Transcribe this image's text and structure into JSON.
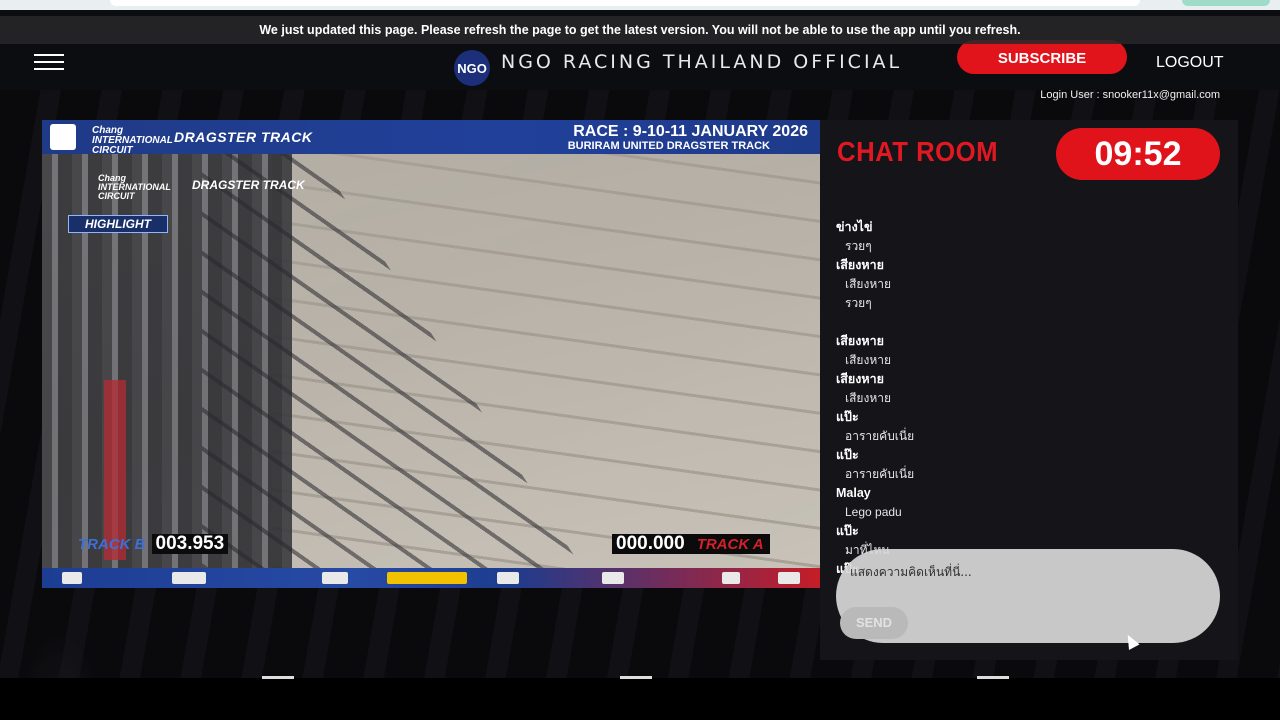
{
  "banner": {
    "text": "We just updated this page. Please refresh the page to get the latest version. You will not be able to use the app until you refresh."
  },
  "header": {
    "title": "NGO RACING THAILAND OFFICIAL",
    "subscribe_label": "SUBSCRIBE",
    "logout_label": "LOGOUT",
    "login_user": "Login User : snooker11x@gmail.com"
  },
  "video": {
    "brand_chang_1": "Chang",
    "brand_chang_2": "INTERNATIONAL",
    "brand_chang_3": "CIRCUIT",
    "brand_dragster": "DRAGSTER TRACK",
    "race_title": "RACE : 9-10-11 JANUARY 2026",
    "race_subtitle": "BURIRAM UNITED DRAGSTER TRACK",
    "highlight": "HIGHLIGHT",
    "left_track": "TRACK B",
    "left_time": "003.953",
    "right_time": "000.000",
    "right_track": "TRACK A"
  },
  "chat": {
    "title": "CHAT ROOM",
    "timer": "09:52",
    "messages": [
      {
        "user": "ข่างไข่",
        "text": "รวยๆ"
      },
      {
        "user": "เสียงหาย",
        "text": "เสียงหาย"
      },
      {
        "user": "",
        "text": "รวยๆ"
      },
      {
        "user": "",
        "text": ""
      },
      {
        "user": "เสียงหาย",
        "text": "เสียงหาย"
      },
      {
        "user": "เสียงหาย",
        "text": "เสียงหาย"
      },
      {
        "user": "แป๊ะ",
        "text": "อารายคับเนี่ย"
      },
      {
        "user": "แป๊ะ",
        "text": "อารายคับเนี่ย"
      },
      {
        "user": "Malay",
        "text": "Lego padu"
      },
      {
        "user": "แป๊ะ",
        "text": "มาที่ไหน"
      },
      {
        "user": "แป๊ะ",
        "text": ""
      }
    ],
    "input_placeholder": "แสดงความคิดเห็นที่นี่...",
    "send_label": "SEND"
  },
  "colors": {
    "accent_red": "#e0141a",
    "header_bg": "#0c0d11",
    "chat_bg": "#141419",
    "overlay_blue": "#21409a"
  }
}
